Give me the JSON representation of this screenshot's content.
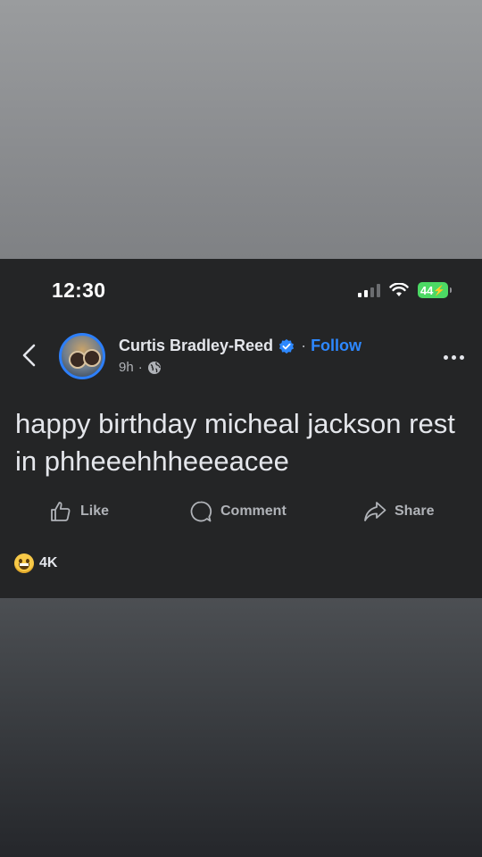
{
  "status_bar": {
    "time": "12:30",
    "battery": "44"
  },
  "post": {
    "author": "Curtis Bradley-Reed",
    "follow_label": "Follow",
    "time_ago": "9h",
    "text": "happy birthday micheal jackson rest in phheeehhheeeacee"
  },
  "actions": {
    "like": "Like",
    "comment": "Comment",
    "share": "Share"
  },
  "reactions": {
    "count": "4K"
  },
  "icons": [
    "back-icon",
    "verified-badge-icon",
    "globe-icon",
    "more-options-icon",
    "like-icon",
    "comment-icon",
    "share-icon",
    "haha-reaction-icon",
    "signal-icon",
    "wifi-icon",
    "battery-icon"
  ],
  "colors": {
    "accent": "#2d88ff",
    "background": "#242526",
    "battery": "#4cd964"
  }
}
